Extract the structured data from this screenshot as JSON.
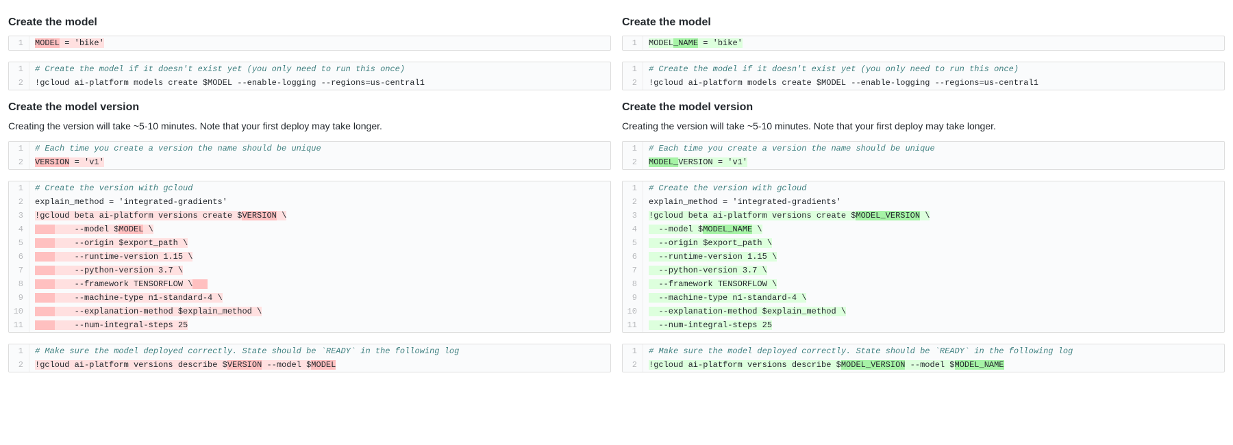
{
  "headings": {
    "create_model": "Create the model",
    "create_version": "Create the model version"
  },
  "desc": {
    "version_note": "Creating the version will take ~5-10 minutes. Note that your first deploy may take longer."
  },
  "left": {
    "model_assign_var": "MODEL",
    "model_assign_tail": " = 'bike'",
    "create_model_comment": "# Create the model if it doesn't exist yet (you only need to run this once)",
    "create_model_cmd": "!gcloud ai-platform models create $MODEL --enable-logging --regions=us-central1",
    "version_comment": "# Each time you create a version the name should be unique",
    "version_var_pre": "",
    "version_var": "VERSION",
    "version_tail": " = 'v1'",
    "vc_comment": "# Create the version with gcloud",
    "vc_l2": "explain_method = 'integrated-gradients'",
    "vc_l3_a": "!gcloud beta ai-platform versions create $",
    "vc_l3_b": "VERSION",
    "vc_l3_c": " \\",
    "vc_l4_a": "    --model $",
    "vc_l4_b": "MODEL",
    "vc_l4_c": " \\",
    "vc_l5": "    --origin $export_path \\",
    "vc_l6": "    --runtime-version 1.15 \\",
    "vc_l7": "    --python-version 3.7 \\",
    "vc_l8": "    --framework TENSORFLOW \\",
    "vc_l9": "    --machine-type n1-standard-4 \\",
    "vc_l10": "    --explanation-method $explain_method \\",
    "vc_l11": "    --num-integral-steps 25",
    "desc_comment": "# Make sure the model deployed correctly. State should be `READY` in the following log",
    "desc_cmd_a": "!gcloud ai-platform versions describe $",
    "desc_cmd_b": "VERSION",
    "desc_cmd_c": " --model $",
    "desc_cmd_d": "MODEL",
    "pad_prefix_4sp": "    ",
    "pad_suffix_3sp": "   "
  },
  "right": {
    "model_assign_pre": "MODEL",
    "model_assign_ins": "_NAME",
    "model_assign_tail": " = 'bike'",
    "create_model_comment": "# Create the model if it doesn't exist yet (you only need to run this once)",
    "create_model_cmd": "!gcloud ai-platform models create $MODEL --enable-logging --regions=us-central1",
    "version_comment": "# Each time you create a version the name should be unique",
    "version_var_pre": "MODEL_",
    "version_var": "VERSION",
    "version_tail": " = 'v1'",
    "vc_comment": "# Create the version with gcloud",
    "vc_l2": "explain_method = 'integrated-gradients'",
    "vc_l3_a": "!gcloud beta ai-platform versions create $",
    "vc_l3_b": "MODEL_VERSION",
    "vc_l3_c": " \\",
    "vc_l4_a": "  --model $",
    "vc_l4_b": "MODEL_NAME",
    "vc_l4_c": " \\",
    "vc_l5": "  --origin $export_path \\",
    "vc_l6": "  --runtime-version 1.15 \\",
    "vc_l7": "  --python-version 3.7 \\",
    "vc_l8": "  --framework TENSORFLOW \\",
    "vc_l9": "  --machine-type n1-standard-4 \\",
    "vc_l10": "  --explanation-method $explain_method \\",
    "vc_l11": "  --num-integral-steps 25",
    "desc_comment": "# Make sure the model deployed correctly. State should be `READY` in the following log",
    "desc_cmd_a": "!gcloud ai-platform versions describe $",
    "desc_cmd_b": "MODEL_VERSION",
    "desc_cmd_c": " --model $",
    "desc_cmd_d": "MODEL_NAME"
  },
  "ln": {
    "1": "1",
    "2": "2",
    "3": "3",
    "4": "4",
    "5": "5",
    "6": "6",
    "7": "7",
    "8": "8",
    "9": "9",
    "10": "10",
    "11": "11"
  }
}
